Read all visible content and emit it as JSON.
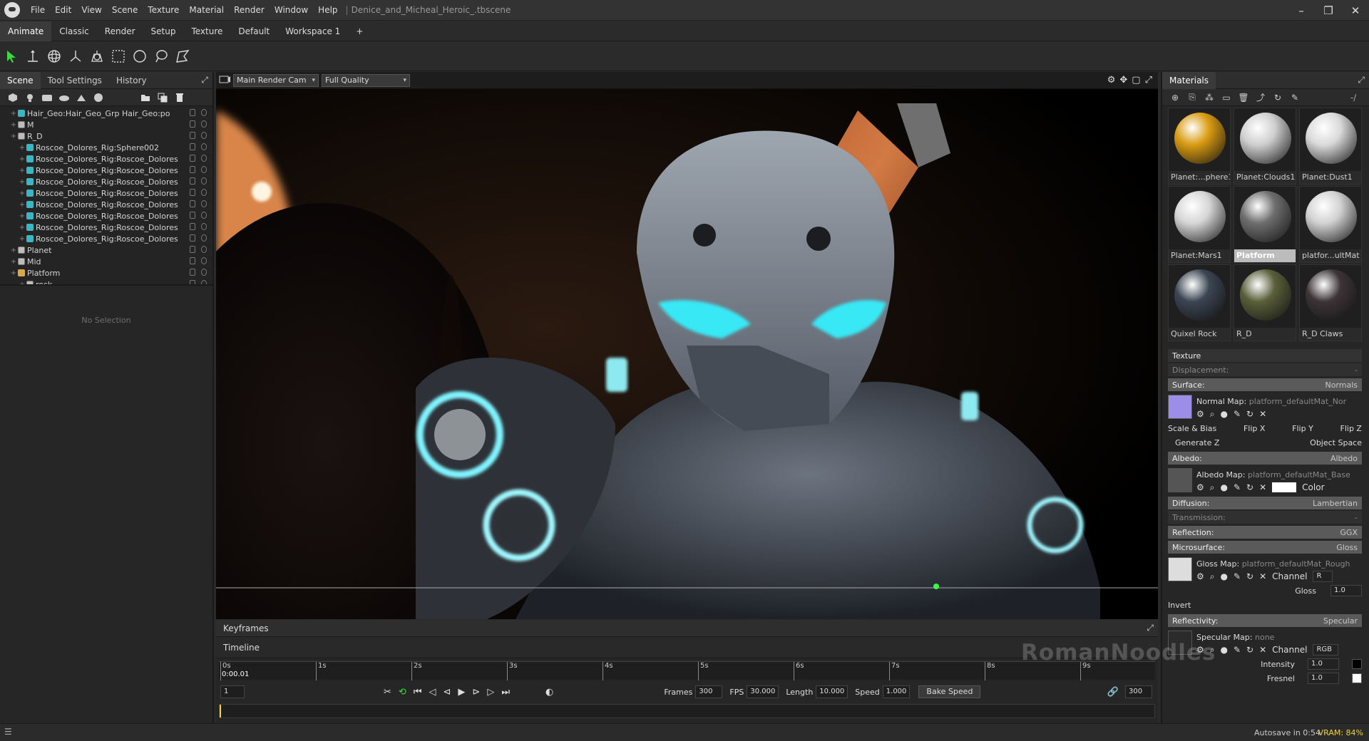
{
  "app": {
    "menu": [
      "File",
      "Edit",
      "View",
      "Scene",
      "Texture",
      "Material",
      "Render",
      "Window",
      "Help"
    ],
    "file_name": "Denice_and_Micheal_Heroic_.tbscene"
  },
  "workspace_tabs": [
    "Animate",
    "Classic",
    "Render",
    "Setup",
    "Texture",
    "Default",
    "Workspace 1",
    "+"
  ],
  "toolbar_icons": [
    "select-arrow-icon",
    "move-icon",
    "rotate-icon",
    "scale-icon",
    "global-icon",
    "rect-select-icon",
    "circle-select-icon",
    "lasso-icon",
    "poly-select-icon"
  ],
  "left_panel": {
    "tabs": [
      "Scene",
      "Tool Settings",
      "History"
    ],
    "no_selection": "No Selection",
    "tree": [
      {
        "label": "Hair_Geo:Hair_Geo_Grp Hair_Geo:po",
        "type": "mesh",
        "indent": 1
      },
      {
        "label": "M",
        "type": "grp",
        "indent": 1
      },
      {
        "label": "R_D",
        "type": "grp",
        "indent": 1
      },
      {
        "label": "Roscoe_Dolores_Rig:Sphere002",
        "type": "mesh",
        "indent": 2
      },
      {
        "label": "Roscoe_Dolores_Rig:Roscoe_Dolores",
        "type": "mesh",
        "indent": 2
      },
      {
        "label": "Roscoe_Dolores_Rig:Roscoe_Dolores",
        "type": "mesh",
        "indent": 2
      },
      {
        "label": "Roscoe_Dolores_Rig:Roscoe_Dolores",
        "type": "mesh",
        "indent": 2
      },
      {
        "label": "Roscoe_Dolores_Rig:Roscoe_Dolores",
        "type": "mesh",
        "indent": 2
      },
      {
        "label": "Roscoe_Dolores_Rig:Roscoe_Dolores",
        "type": "mesh",
        "indent": 2
      },
      {
        "label": "Roscoe_Dolores_Rig:Roscoe_Dolores",
        "type": "mesh",
        "indent": 2
      },
      {
        "label": "Roscoe_Dolores_Rig:Roscoe_Dolores",
        "type": "mesh",
        "indent": 2
      },
      {
        "label": "Roscoe_Dolores_Rig:Roscoe_Dolores",
        "type": "mesh",
        "indent": 2
      },
      {
        "label": "Planet",
        "type": "grp",
        "indent": 1
      },
      {
        "label": "Mid",
        "type": "grp",
        "indent": 1
      },
      {
        "label": "Platform",
        "type": "fold",
        "indent": 1
      },
      {
        "label": "rock",
        "type": "grp",
        "indent": 2
      }
    ]
  },
  "viewport": {
    "camera": "Main Render Cam",
    "quality": "Full Quality"
  },
  "materials": {
    "title": "Materials",
    "search": "-/",
    "items": [
      {
        "label": "Planet:...phere1",
        "color": "#d99b12"
      },
      {
        "label": "Planet:Clouds1",
        "color": "#cfcfcf"
      },
      {
        "label": "Planet:Dust1",
        "color": "#dadada"
      },
      {
        "label": "Planet:Mars1",
        "color": "#d6d6d6"
      },
      {
        "label": "Platform",
        "color": "#6e6e6e",
        "selected": true
      },
      {
        "label": "platfor...ultMat",
        "color": "#d2d2d2"
      },
      {
        "label": "Quixel Rock",
        "color": "#3b4552"
      },
      {
        "label": "R_D",
        "color": "#5a5f3a"
      },
      {
        "label": "R_D Claws",
        "color": "#3c3436"
      },
      {
        "label": "",
        "color": "#c7a877"
      },
      {
        "label": "",
        "color": "#5a5a5a"
      },
      {
        "label": "",
        "color": "#d21010"
      }
    ]
  },
  "props": {
    "texture": "Texture",
    "displacement": "Displacement:",
    "displacement_v": "-",
    "surface": "Surface:",
    "surface_v": "Normals",
    "normal_map": "Normal Map:",
    "normal_map_v": "platform_defaultMat_Nor",
    "scale_bias": "Scale & Bias",
    "flip_x": "Flip X",
    "flip_y": "Flip Y",
    "flip_z": "Flip Z",
    "generate_z": "Generate Z",
    "object_space": "Object Space",
    "albedo": "Albedo:",
    "albedo_v": "Albedo",
    "albedo_map": "Albedo Map:",
    "albedo_map_v": "platform_defaultMat_Base",
    "color": "Color",
    "diffusion": "Diffusion:",
    "diffusion_v": "Lambertian",
    "transmission": "Transmission:",
    "transmission_v": "-",
    "reflection": "Reflection:",
    "reflection_v": "GGX",
    "microsurface": "Microsurface:",
    "microsurface_v": "Gloss",
    "gloss_map": "Gloss Map:",
    "gloss_map_v": "platform_defaultMat_Rough",
    "channel": "Channel",
    "channel_v": "R",
    "gloss": "Gloss",
    "gloss_v": "1.0",
    "invert": "Invert",
    "reflectivity": "Reflectivity:",
    "reflectivity_v": "Specular",
    "specular_map": "Specular Map:",
    "specular_map_v": "none",
    "channel2_v": "RGB",
    "intensity": "Intensity",
    "intensity_v": "1.0",
    "fresnel": "Fresnel",
    "fresnel_v": "1.0"
  },
  "timeline": {
    "tabs": [
      "Keyframes",
      "Timeline"
    ],
    "current_time": "0:00.01",
    "current_frame": "1",
    "ticks": [
      "0s",
      "1s",
      "2s",
      "3s",
      "4s",
      "5s",
      "6s",
      "7s",
      "8s",
      "9s"
    ],
    "frames_label": "Frames",
    "frames": "300",
    "fps_label": "FPS",
    "fps": "30.000",
    "length_label": "Length",
    "length": "10.000",
    "speed_label": "Speed",
    "speed": "1.000",
    "bake_speed": "Bake Speed",
    "end_frame": "300"
  },
  "status": {
    "autosave": "Autosave in 0:54",
    "vram": "VRAM: 84%"
  },
  "watermark": "RomanNoodles"
}
